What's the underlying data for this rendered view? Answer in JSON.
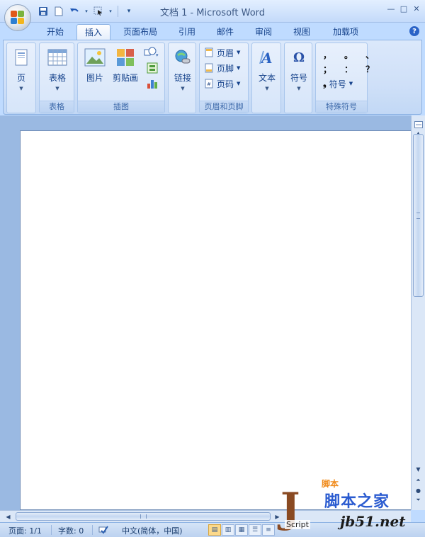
{
  "window": {
    "title": "文档 1 - Microsoft Word",
    "controls": [
      "—",
      "□",
      "✕"
    ]
  },
  "qat": {
    "save_icon": "save-icon",
    "new_icon": "new-doc-icon",
    "undo_icon": "undo-icon",
    "pointer_icon": "select-icon",
    "customize_icon": "customize-icon"
  },
  "tabs": [
    "开始",
    "插入",
    "页面布局",
    "引用",
    "邮件",
    "审阅",
    "视图",
    "加载项"
  ],
  "active_tab": "插入",
  "help": "?",
  "ribbon": {
    "pages": {
      "label": "页",
      "group": ""
    },
    "tables": {
      "label": "表格",
      "group": "表格"
    },
    "illustrations": {
      "group": "插图",
      "picture": "图片",
      "clipart": "剪贴画"
    },
    "links": {
      "label": "链接",
      "group": ""
    },
    "header_footer": {
      "group": "页眉和页脚",
      "header": "页眉",
      "footer": "页脚",
      "page_number": "页码"
    },
    "text": {
      "label": "文本",
      "group": ""
    },
    "symbols": {
      "label": "符号",
      "group": ""
    },
    "special": {
      "group": "特殊符号",
      "row1": [
        "，",
        "。",
        "、"
      ],
      "row2": [
        "；",
        "：",
        "？"
      ],
      "symbol_label": "符号"
    }
  },
  "status": {
    "page": "页面: 1/1",
    "words": "字数: 0",
    "language": "中文(简体，中国)"
  },
  "watermark": {
    "j": "J",
    "script": "Script",
    "top": "脚本",
    "cn": "脚本之家",
    "url": "jb51.net"
  }
}
